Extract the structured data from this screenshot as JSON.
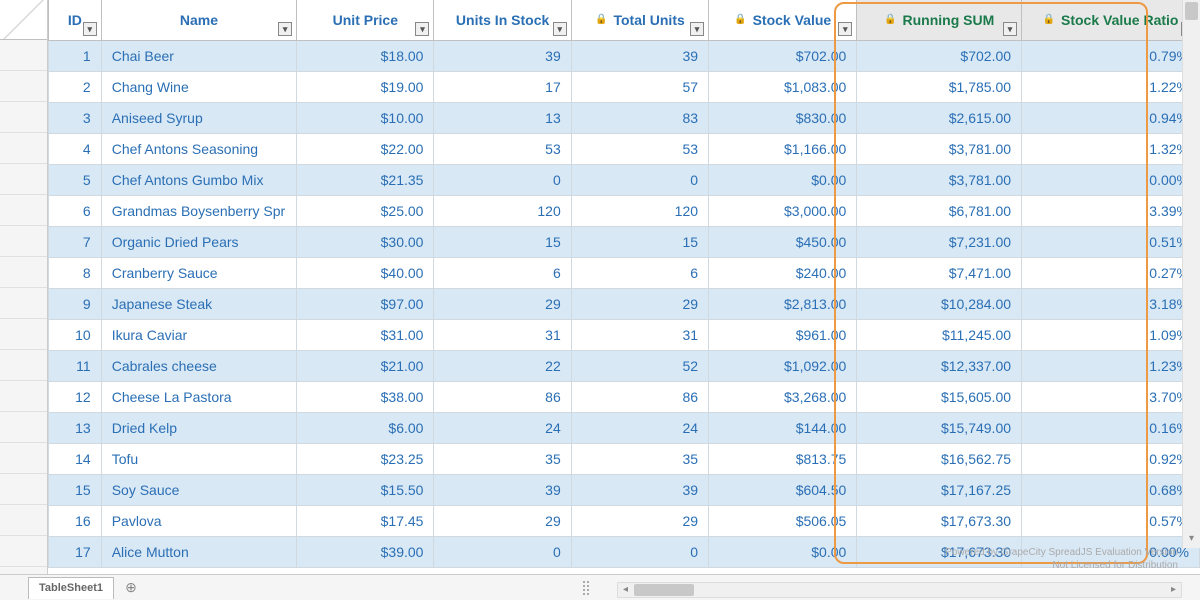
{
  "columns": [
    {
      "key": "id",
      "label": "ID",
      "cls": "c-id",
      "locked": false,
      "highlight": false
    },
    {
      "key": "name",
      "label": "Name",
      "cls": "c-name",
      "locked": false,
      "highlight": false
    },
    {
      "key": "price",
      "label": "Unit Price",
      "cls": "c-price",
      "locked": false,
      "highlight": false
    },
    {
      "key": "stock",
      "label": "Units In Stock",
      "cls": "c-stock",
      "locked": false,
      "highlight": false
    },
    {
      "key": "total",
      "label": "Total Units",
      "cls": "c-total",
      "locked": true,
      "highlight": false
    },
    {
      "key": "value",
      "label": "Stock Value",
      "cls": "c-value",
      "locked": true,
      "highlight": false
    },
    {
      "key": "run",
      "label": "Running SUM",
      "cls": "c-run",
      "locked": true,
      "highlight": true
    },
    {
      "key": "ratio",
      "label": "Stock Value Ratio",
      "cls": "c-ratio",
      "locked": true,
      "highlight": true
    }
  ],
  "rows": [
    {
      "id": "1",
      "name": "Chai Beer",
      "price": "$18.00",
      "stock": "39",
      "total": "39",
      "value": "$702.00",
      "run": "$702.00",
      "ratio": "0.79%"
    },
    {
      "id": "2",
      "name": "Chang Wine",
      "price": "$19.00",
      "stock": "17",
      "total": "57",
      "value": "$1,083.00",
      "run": "$1,785.00",
      "ratio": "1.22%"
    },
    {
      "id": "3",
      "name": "Aniseed Syrup",
      "price": "$10.00",
      "stock": "13",
      "total": "83",
      "value": "$830.00",
      "run": "$2,615.00",
      "ratio": "0.94%"
    },
    {
      "id": "4",
      "name": "Chef Antons Seasoning",
      "price": "$22.00",
      "stock": "53",
      "total": "53",
      "value": "$1,166.00",
      "run": "$3,781.00",
      "ratio": "1.32%"
    },
    {
      "id": "5",
      "name": "Chef Antons Gumbo Mix",
      "price": "$21.35",
      "stock": "0",
      "total": "0",
      "value": "$0.00",
      "run": "$3,781.00",
      "ratio": "0.00%"
    },
    {
      "id": "6",
      "name": "Grandmas Boysenberry Spr",
      "price": "$25.00",
      "stock": "120",
      "total": "120",
      "value": "$3,000.00",
      "run": "$6,781.00",
      "ratio": "3.39%"
    },
    {
      "id": "7",
      "name": "Organic Dried Pears",
      "price": "$30.00",
      "stock": "15",
      "total": "15",
      "value": "$450.00",
      "run": "$7,231.00",
      "ratio": "0.51%"
    },
    {
      "id": "8",
      "name": "Cranberry Sauce",
      "price": "$40.00",
      "stock": "6",
      "total": "6",
      "value": "$240.00",
      "run": "$7,471.00",
      "ratio": "0.27%"
    },
    {
      "id": "9",
      "name": "Japanese Steak",
      "price": "$97.00",
      "stock": "29",
      "total": "29",
      "value": "$2,813.00",
      "run": "$10,284.00",
      "ratio": "3.18%"
    },
    {
      "id": "10",
      "name": "Ikura Caviar",
      "price": "$31.00",
      "stock": "31",
      "total": "31",
      "value": "$961.00",
      "run": "$11,245.00",
      "ratio": "1.09%"
    },
    {
      "id": "11",
      "name": "Cabrales cheese",
      "price": "$21.00",
      "stock": "22",
      "total": "52",
      "value": "$1,092.00",
      "run": "$12,337.00",
      "ratio": "1.23%"
    },
    {
      "id": "12",
      "name": "Cheese La Pastora",
      "price": "$38.00",
      "stock": "86",
      "total": "86",
      "value": "$3,268.00",
      "run": "$15,605.00",
      "ratio": "3.70%"
    },
    {
      "id": "13",
      "name": "Dried Kelp",
      "price": "$6.00",
      "stock": "24",
      "total": "24",
      "value": "$144.00",
      "run": "$15,749.00",
      "ratio": "0.16%"
    },
    {
      "id": "14",
      "name": "Tofu",
      "price": "$23.25",
      "stock": "35",
      "total": "35",
      "value": "$813.75",
      "run": "$16,562.75",
      "ratio": "0.92%"
    },
    {
      "id": "15",
      "name": "Soy Sauce",
      "price": "$15.50",
      "stock": "39",
      "total": "39",
      "value": "$604.50",
      "run": "$17,167.25",
      "ratio": "0.68%"
    },
    {
      "id": "16",
      "name": "Pavlova",
      "price": "$17.45",
      "stock": "29",
      "total": "29",
      "value": "$506.05",
      "run": "$17,673.30",
      "ratio": "0.57%"
    },
    {
      "id": "17",
      "name": "Alice Mutton",
      "price": "$39.00",
      "stock": "0",
      "total": "0",
      "value": "$0.00",
      "run": "$17,673.30",
      "ratio": "0.00%"
    }
  ],
  "sheet_tab": "TableSheet1",
  "watermark_line1": "Powered by GrapeCity SpreadJS Evaluation Version",
  "watermark_line2": "Not Licensed for Distribution",
  "tab_add_glyph": "⊕",
  "filter_glyph": "▾",
  "lock_glyph": "🔒"
}
